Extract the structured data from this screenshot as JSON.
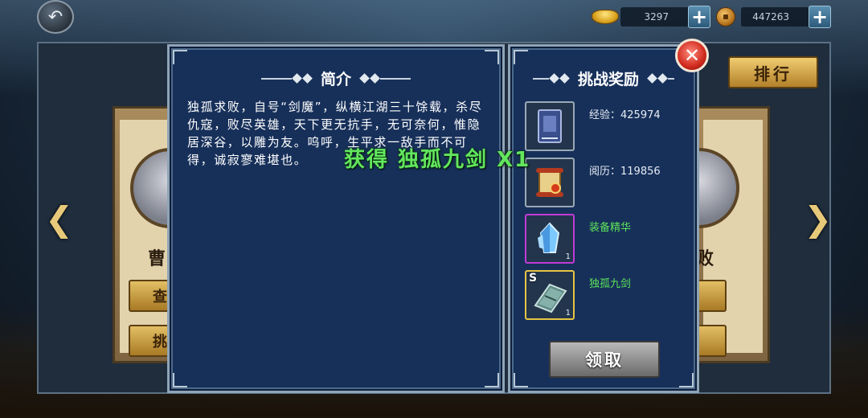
{
  "topbar": {
    "back_icon": "back-arrow-icon",
    "ingot": {
      "icon": "gold-ingot-icon",
      "value": "3297"
    },
    "coin": {
      "icon": "copper-coin-icon",
      "value": "447263"
    },
    "plus_label": "+"
  },
  "background": {
    "left_card": {
      "name": "曹",
      "btn1": "查",
      "btn2": "挑"
    },
    "right_card": {
      "name": "败"
    },
    "rank_label": "排行",
    "arrow_left": "❮",
    "arrow_right": "❯"
  },
  "intro": {
    "title": "简介",
    "text": "独孤求败，自号“剑魔”，纵横江湖三十馀载，杀尽仇寇，败尽英雄，天下更无抗手，无可奈何，惟隐居深谷，以雕为友。呜呼，生平求一敌手而不可得，诚寂寥难堪也。"
  },
  "rewards": {
    "title": "挑战奖励",
    "close_label": "✕",
    "items": [
      {
        "label": "经验：425974",
        "icon": "book-icon",
        "count": "",
        "highlight": false
      },
      {
        "label": "阅历：119856",
        "icon": "scroll-icon",
        "count": "",
        "highlight": false
      },
      {
        "label": "装备精华",
        "icon": "crystal-icon",
        "count": "1",
        "highlight": true
      },
      {
        "label": "独孤九剑",
        "icon": "manual-icon",
        "count": "1",
        "highlight": true,
        "grade": "S"
      }
    ],
    "claim_label": "领取"
  },
  "toast": "获得 独孤九剑 X1"
}
